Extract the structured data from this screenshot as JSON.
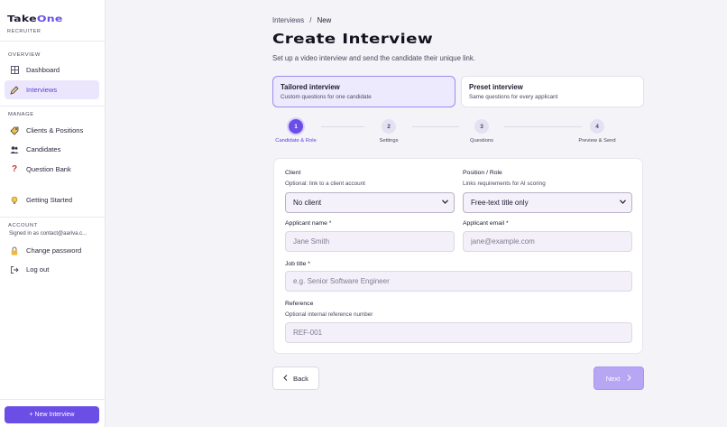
{
  "brand": {
    "name_main": "Take",
    "name_accent": "One",
    "sub": "RECRUITER"
  },
  "sidebar": {
    "sections": {
      "overview": "OVERVIEW",
      "manage": "MANAGE",
      "account": "ACCOUNT"
    },
    "items": {
      "dashboard": "Dashboard",
      "interviews": "Interviews",
      "clients": "Clients & Positions",
      "candidates": "Candidates",
      "question_bank": "Question Bank",
      "getting_started": "Getting Started",
      "change_password": "Change password",
      "logout": "Log out"
    },
    "signed_in": "Signed in as contact@aariva.c...",
    "new_interview": "+ New Interview"
  },
  "breadcrumb": {
    "parent": "Interviews",
    "sep": "/",
    "current": "New"
  },
  "page": {
    "title": "Create Interview",
    "subtitle": "Set up a video interview and send the candidate their unique link."
  },
  "interview_types": [
    {
      "title": "Tailored interview",
      "desc": "Custom questions for one candidate",
      "selected": true
    },
    {
      "title": "Preset interview",
      "desc": "Same questions for every applicant",
      "selected": false
    }
  ],
  "steps": [
    {
      "num": "1",
      "label": "Candidate & Role",
      "active": true
    },
    {
      "num": "2",
      "label": "Settings",
      "active": false
    },
    {
      "num": "3",
      "label": "Questions",
      "active": false
    },
    {
      "num": "4",
      "label": "Preview & Send",
      "active": false
    }
  ],
  "form": {
    "client": {
      "label": "Client",
      "help": "Optional: link to a client account",
      "value": "No client"
    },
    "position": {
      "label": "Position / Role",
      "help": "Links requirements for AI scoring",
      "value": "Free-text title only"
    },
    "applicant_name": {
      "label": "Applicant name *",
      "placeholder": "Jane Smith"
    },
    "applicant_email": {
      "label": "Applicant email *",
      "placeholder": "jane@example.com"
    },
    "job_title": {
      "label": "Job title *",
      "placeholder": "e.g. Senior Software Engineer"
    },
    "reference": {
      "label": "Reference",
      "help": "Optional internal reference number",
      "placeholder": "REF-001"
    }
  },
  "nav_buttons": {
    "back": "Back",
    "next": "Next"
  },
  "icons": {
    "dashboard": "grid-icon",
    "interviews": "pen-icon",
    "clients": "tag-icon",
    "candidates": "people-icon",
    "question_bank": "question-icon",
    "getting_started": "lightbulb-icon",
    "change_password": "lock-icon",
    "logout": "logout-icon"
  },
  "colors": {
    "accent": "#6b4ee6",
    "accent_light": "#ece6fc",
    "next_disabled": "#b6a6f3"
  }
}
